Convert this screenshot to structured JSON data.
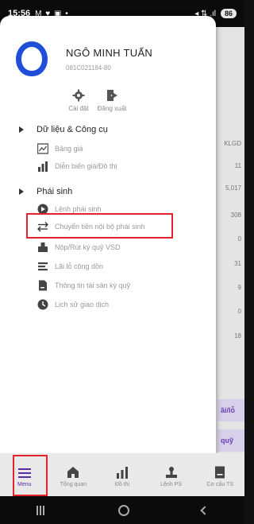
{
  "status_bar": {
    "time": "15:56",
    "left_icons": "M ♥ ▣ •",
    "right_icons": "◂ ⇅ .ıl",
    "battery": "86"
  },
  "user": {
    "name": "NGÔ MINH TUẤN",
    "account_id": "081C021184-80"
  },
  "actions": [
    {
      "label": "Cài đặt",
      "icon": "gear-icon"
    },
    {
      "label": "Đăng xuất",
      "icon": "logout-icon"
    }
  ],
  "sections": [
    {
      "title": "Dữ liệu & Công cụ"
    },
    {
      "title": "Phái sinh"
    }
  ],
  "data_tools_items": [
    {
      "label": "Bảng giá",
      "icon": "price-board-icon"
    },
    {
      "label": "Diễn biến giá/Đồ thị",
      "icon": "chart-icon"
    }
  ],
  "derivative_items": [
    {
      "label": "Lệnh phái sinh",
      "icon": "arrow-circle-icon"
    },
    {
      "label": "Chuyển tiền nội bộ phái sinh",
      "icon": "transfer-icon"
    },
    {
      "label": "Nộp/Rút ký quỹ VSD",
      "icon": "deposit-icon"
    },
    {
      "label": "Lãi lỗ cộng dồn",
      "icon": "profit-loss-icon"
    },
    {
      "label": "Thông tin tài sản ký quỹ",
      "icon": "document-icon"
    },
    {
      "label": "Lịch sử giao dịch",
      "icon": "clock-icon"
    }
  ],
  "background": {
    "column_header": "KLGD",
    "values": [
      "11",
      "5,017",
      "308",
      "0",
      "31",
      "9",
      "0",
      "18"
    ],
    "buttons": [
      "ãi/lỗ",
      "quỹ"
    ]
  },
  "bottom_nav": [
    {
      "label": "Menu",
      "icon": "menu-icon",
      "active": true
    },
    {
      "label": "Tổng quan",
      "icon": "home-icon",
      "active": false
    },
    {
      "label": "Đồ thị",
      "icon": "chart-icon",
      "active": false
    },
    {
      "label": "Lệnh PS",
      "icon": "order-icon",
      "active": false
    },
    {
      "label": "Cơ cấu TS",
      "icon": "portfolio-icon",
      "active": false
    }
  ],
  "colors": {
    "accent": "#5a2ca8",
    "avatar_blue": "#1f4fd8",
    "highlight_red": "#e3232e"
  }
}
